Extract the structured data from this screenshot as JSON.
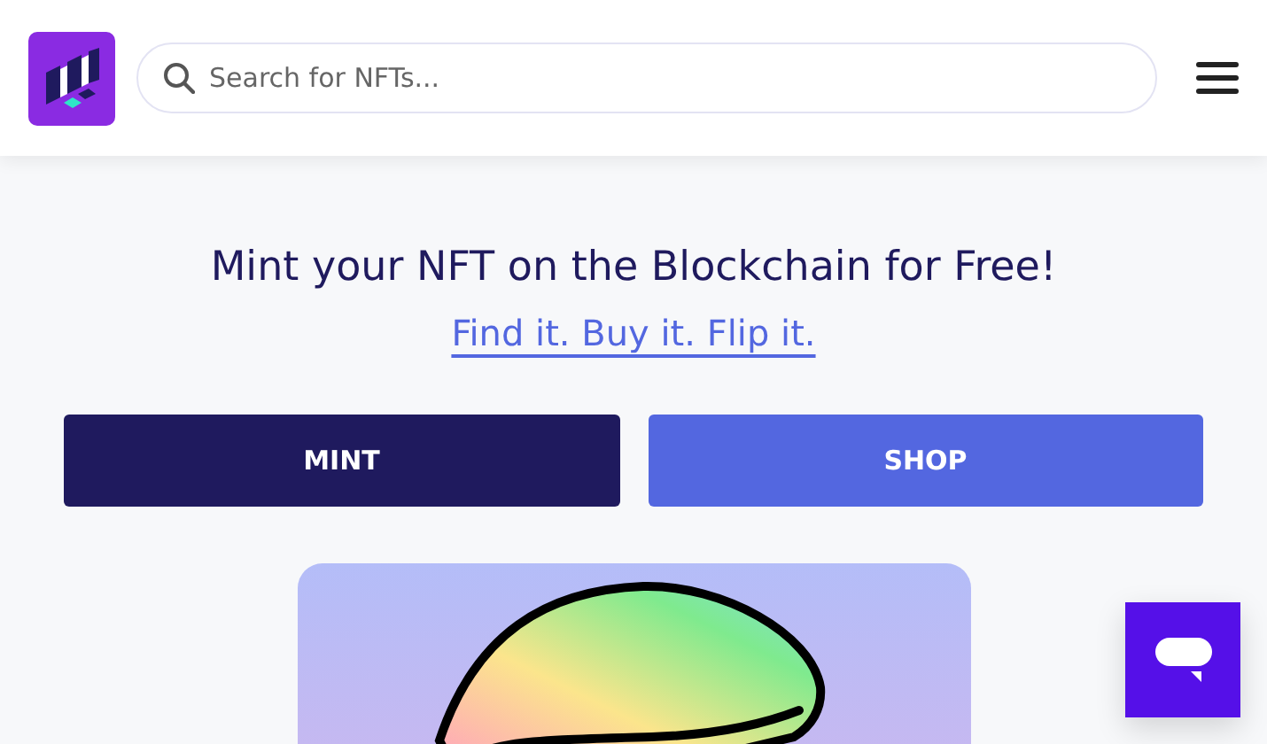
{
  "search": {
    "placeholder": "Search for NFTs..."
  },
  "hero": {
    "title": "Mint your NFT on the Blockchain for Free!",
    "link": "Find it. Buy it. Flip it."
  },
  "buttons": [
    {
      "label": "MINT",
      "kind": "primary"
    },
    {
      "label": "SHOP",
      "kind": "secondary"
    }
  ]
}
